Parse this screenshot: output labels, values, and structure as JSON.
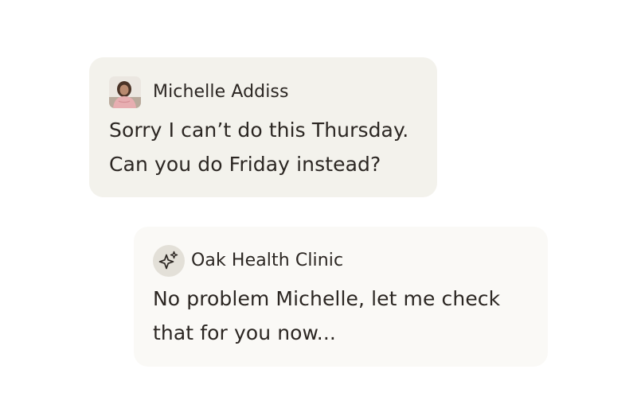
{
  "messages": [
    {
      "sender": "Michelle Addiss",
      "avatar_icon": "person-photo-icon",
      "lines": [
        "Sorry I can’t do this Thursday.",
        "Can you do Friday instead?"
      ]
    },
    {
      "sender": "Oak Health Clinic",
      "avatar_icon": "sparkle-icon",
      "lines": [
        "No problem Michelle, let me check",
        "that for you now..."
      ]
    }
  ],
  "colors": {
    "patient_bubble": "#f3f2ec",
    "clinic_bubble": "#faf9f6",
    "ai_badge": "#e3e0d8",
    "text": "#2b2622"
  }
}
